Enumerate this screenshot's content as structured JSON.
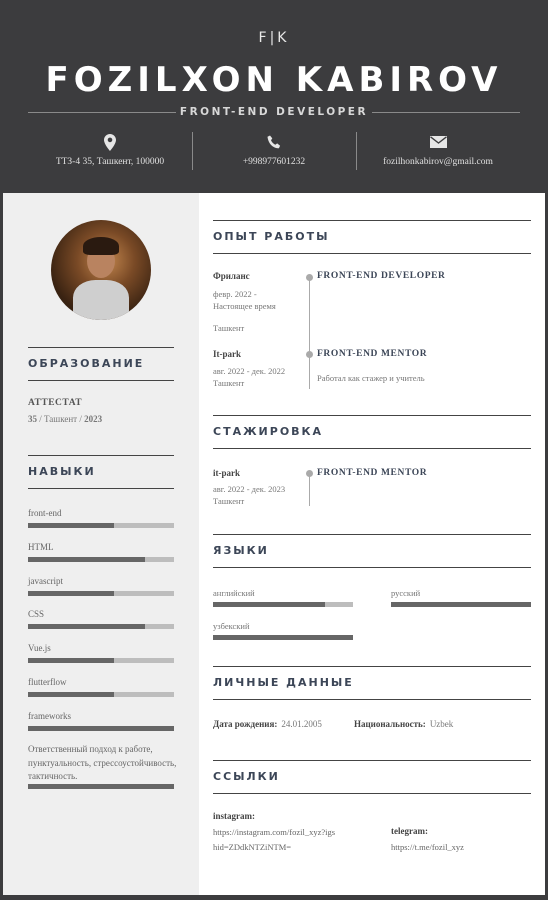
{
  "header": {
    "monogram": "F|K",
    "name": "FOZILXON KABIROV",
    "role": "FRONT-END DEVELOPER",
    "contacts": [
      {
        "icon": "location-pin-icon",
        "text": "ТТЗ-4 35, Ташкент, 100000"
      },
      {
        "icon": "phone-icon",
        "text": "+998977601232"
      },
      {
        "icon": "envelope-icon",
        "text": "fozilhonkabirov@gmail.com"
      }
    ]
  },
  "sidebar": {
    "education": {
      "title": "ОБРАЗОВАНИЕ",
      "degree": "АТТЕСТАТ",
      "school": "35",
      "sep1": " / ",
      "city": "Ташкент",
      "sep2": " / ",
      "year": "2023"
    },
    "skills": {
      "title": "НАВЫКИ",
      "items": [
        {
          "label": "front-end",
          "level": 0.59
        },
        {
          "label": "HTML",
          "level": 0.8
        },
        {
          "label": "javascript",
          "level": 0.59
        },
        {
          "label": "CSS",
          "level": 0.8
        },
        {
          "label": "Vue.js",
          "level": 0.59
        },
        {
          "label": "flutterflow",
          "level": 0.59
        },
        {
          "label": "frameworks",
          "level": 1.0
        }
      ],
      "note": "Ответственный подход к работе, пунктуальность, стрессоустойчивость, тактичность.",
      "note_level": 1.0
    }
  },
  "main": {
    "experience": {
      "title": "ОПЫТ РАБОТЫ",
      "jobs": [
        {
          "company": "Фриланс",
          "dates": "февр. 2022 - Настоящее время",
          "city": "Ташкент",
          "title": "FRONT-END DEVELOPER",
          "desc": ""
        },
        {
          "company": "It-park",
          "dates": "авг. 2022 - дек. 2022",
          "city": "Ташкент",
          "title": "FRONT-END MENTOR",
          "desc": "Работал как стажер и учитель"
        }
      ]
    },
    "internship": {
      "title": "СТАЖИРОВКА",
      "company": "it-park",
      "dates": "авг. 2022 - дек. 2023",
      "city": "Ташкент",
      "job_title": "FRONT-END MENTOR"
    },
    "languages": {
      "title": "ЯЗЫКИ",
      "items": [
        {
          "label": "английский",
          "level": 0.8
        },
        {
          "label": "русский",
          "level": 1.0
        },
        {
          "label": "узбекский",
          "level": 1.0
        }
      ]
    },
    "personal": {
      "title": "ЛИЧНЫЕ ДАННЫЕ",
      "birth_label": "Дата рождения:",
      "birth_value": "24.01.2005",
      "nat_label": "Национальность:",
      "nat_value": "Uzbek"
    },
    "links": {
      "title": "ССЫЛКИ",
      "instagram_label": "instagram:",
      "instagram_line1": "https://instagram.com/fozil_xyz?igs",
      "instagram_line2": "hid=ZDdkNTZiNTM=",
      "telegram_label": "telegram:",
      "telegram_value": "https://t.me/fozil_xyz"
    }
  },
  "colors": {
    "header_bg": "#3c3c3e",
    "sidebar_bg": "#efefef",
    "title_text": "#3c4657",
    "bar_fill": "#666666",
    "bar_track": "#bdbdbd"
  }
}
